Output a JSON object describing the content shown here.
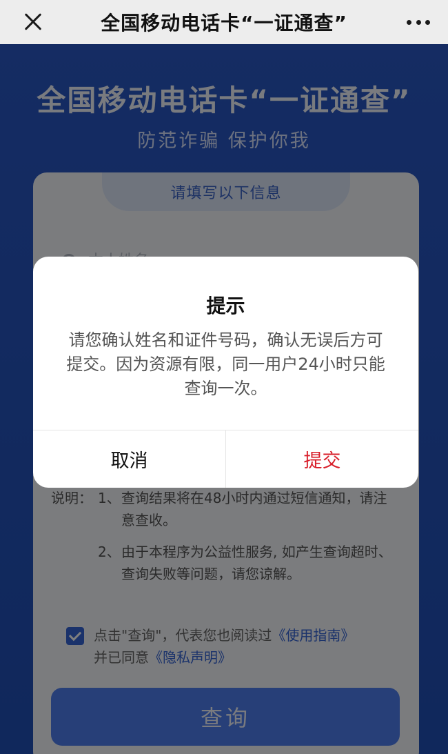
{
  "navbar": {
    "title": "全国移动电话卡“一证通查”",
    "close_icon": "close-icon",
    "more_icon": "more-icon"
  },
  "hero": {
    "title": "全国移动电话卡“一证通查”",
    "subtitle": "防范诈骗 保护你我"
  },
  "form": {
    "tab_label": "请填写以下信息",
    "name_placeholder": "本人姓名",
    "notes_label": "说明：",
    "notes": [
      {
        "num": "1、",
        "text": "查询结果将在48小时内通过短信通知，请注意查收。"
      },
      {
        "num": "2、",
        "text": "由于本程序为公益性服务, 如产生查询超时、查询失败等问题，请您谅解。"
      }
    ],
    "agree": {
      "checked": true,
      "prefix": "点击\"查询\"，代表您也阅读过",
      "guide_link": "《使用指南》",
      "middle": "并已同意",
      "privacy_link": "《隐私声明》"
    },
    "query_button": "查询"
  },
  "dialog": {
    "title": "提示",
    "body": "请您确认姓名和证件号码，确认无误后方可提交。因为资源有限，同一用户24小时只能查询一次。",
    "cancel_label": "取消",
    "submit_label": "提交"
  },
  "colors": {
    "background": "#2453bd",
    "accent": "#3564d6",
    "submit": "#d81e2a"
  }
}
